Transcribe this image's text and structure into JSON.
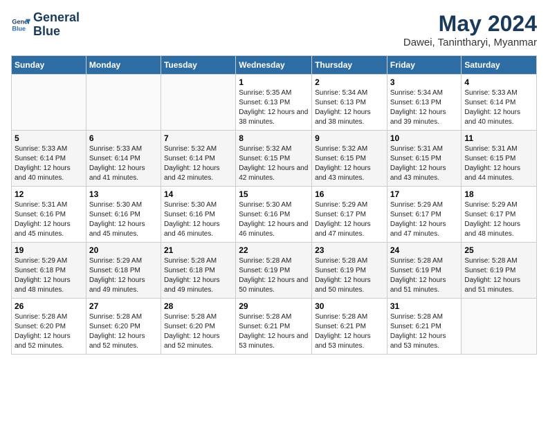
{
  "logo": {
    "line1": "General",
    "line2": "Blue"
  },
  "title": "May 2024",
  "location": "Dawei, Tanintharyi, Myanmar",
  "days_header": [
    "Sunday",
    "Monday",
    "Tuesday",
    "Wednesday",
    "Thursday",
    "Friday",
    "Saturday"
  ],
  "weeks": [
    [
      {
        "day": "",
        "sunrise": "",
        "sunset": "",
        "daylight": ""
      },
      {
        "day": "",
        "sunrise": "",
        "sunset": "",
        "daylight": ""
      },
      {
        "day": "",
        "sunrise": "",
        "sunset": "",
        "daylight": ""
      },
      {
        "day": "1",
        "sunrise": "Sunrise: 5:35 AM",
        "sunset": "Sunset: 6:13 PM",
        "daylight": "Daylight: 12 hours and 38 minutes."
      },
      {
        "day": "2",
        "sunrise": "Sunrise: 5:34 AM",
        "sunset": "Sunset: 6:13 PM",
        "daylight": "Daylight: 12 hours and 38 minutes."
      },
      {
        "day": "3",
        "sunrise": "Sunrise: 5:34 AM",
        "sunset": "Sunset: 6:13 PM",
        "daylight": "Daylight: 12 hours and 39 minutes."
      },
      {
        "day": "4",
        "sunrise": "Sunrise: 5:33 AM",
        "sunset": "Sunset: 6:14 PM",
        "daylight": "Daylight: 12 hours and 40 minutes."
      }
    ],
    [
      {
        "day": "5",
        "sunrise": "Sunrise: 5:33 AM",
        "sunset": "Sunset: 6:14 PM",
        "daylight": "Daylight: 12 hours and 40 minutes."
      },
      {
        "day": "6",
        "sunrise": "Sunrise: 5:33 AM",
        "sunset": "Sunset: 6:14 PM",
        "daylight": "Daylight: 12 hours and 41 minutes."
      },
      {
        "day": "7",
        "sunrise": "Sunrise: 5:32 AM",
        "sunset": "Sunset: 6:14 PM",
        "daylight": "Daylight: 12 hours and 42 minutes."
      },
      {
        "day": "8",
        "sunrise": "Sunrise: 5:32 AM",
        "sunset": "Sunset: 6:15 PM",
        "daylight": "Daylight: 12 hours and 42 minutes."
      },
      {
        "day": "9",
        "sunrise": "Sunrise: 5:32 AM",
        "sunset": "Sunset: 6:15 PM",
        "daylight": "Daylight: 12 hours and 43 minutes."
      },
      {
        "day": "10",
        "sunrise": "Sunrise: 5:31 AM",
        "sunset": "Sunset: 6:15 PM",
        "daylight": "Daylight: 12 hours and 43 minutes."
      },
      {
        "day": "11",
        "sunrise": "Sunrise: 5:31 AM",
        "sunset": "Sunset: 6:15 PM",
        "daylight": "Daylight: 12 hours and 44 minutes."
      }
    ],
    [
      {
        "day": "12",
        "sunrise": "Sunrise: 5:31 AM",
        "sunset": "Sunset: 6:16 PM",
        "daylight": "Daylight: 12 hours and 45 minutes."
      },
      {
        "day": "13",
        "sunrise": "Sunrise: 5:30 AM",
        "sunset": "Sunset: 6:16 PM",
        "daylight": "Daylight: 12 hours and 45 minutes."
      },
      {
        "day": "14",
        "sunrise": "Sunrise: 5:30 AM",
        "sunset": "Sunset: 6:16 PM",
        "daylight": "Daylight: 12 hours and 46 minutes."
      },
      {
        "day": "15",
        "sunrise": "Sunrise: 5:30 AM",
        "sunset": "Sunset: 6:16 PM",
        "daylight": "Daylight: 12 hours and 46 minutes."
      },
      {
        "day": "16",
        "sunrise": "Sunrise: 5:29 AM",
        "sunset": "Sunset: 6:17 PM",
        "daylight": "Daylight: 12 hours and 47 minutes."
      },
      {
        "day": "17",
        "sunrise": "Sunrise: 5:29 AM",
        "sunset": "Sunset: 6:17 PM",
        "daylight": "Daylight: 12 hours and 47 minutes."
      },
      {
        "day": "18",
        "sunrise": "Sunrise: 5:29 AM",
        "sunset": "Sunset: 6:17 PM",
        "daylight": "Daylight: 12 hours and 48 minutes."
      }
    ],
    [
      {
        "day": "19",
        "sunrise": "Sunrise: 5:29 AM",
        "sunset": "Sunset: 6:18 PM",
        "daylight": "Daylight: 12 hours and 48 minutes."
      },
      {
        "day": "20",
        "sunrise": "Sunrise: 5:29 AM",
        "sunset": "Sunset: 6:18 PM",
        "daylight": "Daylight: 12 hours and 49 minutes."
      },
      {
        "day": "21",
        "sunrise": "Sunrise: 5:28 AM",
        "sunset": "Sunset: 6:18 PM",
        "daylight": "Daylight: 12 hours and 49 minutes."
      },
      {
        "day": "22",
        "sunrise": "Sunrise: 5:28 AM",
        "sunset": "Sunset: 6:19 PM",
        "daylight": "Daylight: 12 hours and 50 minutes."
      },
      {
        "day": "23",
        "sunrise": "Sunrise: 5:28 AM",
        "sunset": "Sunset: 6:19 PM",
        "daylight": "Daylight: 12 hours and 50 minutes."
      },
      {
        "day": "24",
        "sunrise": "Sunrise: 5:28 AM",
        "sunset": "Sunset: 6:19 PM",
        "daylight": "Daylight: 12 hours and 51 minutes."
      },
      {
        "day": "25",
        "sunrise": "Sunrise: 5:28 AM",
        "sunset": "Sunset: 6:19 PM",
        "daylight": "Daylight: 12 hours and 51 minutes."
      }
    ],
    [
      {
        "day": "26",
        "sunrise": "Sunrise: 5:28 AM",
        "sunset": "Sunset: 6:20 PM",
        "daylight": "Daylight: 12 hours and 52 minutes."
      },
      {
        "day": "27",
        "sunrise": "Sunrise: 5:28 AM",
        "sunset": "Sunset: 6:20 PM",
        "daylight": "Daylight: 12 hours and 52 minutes."
      },
      {
        "day": "28",
        "sunrise": "Sunrise: 5:28 AM",
        "sunset": "Sunset: 6:20 PM",
        "daylight": "Daylight: 12 hours and 52 minutes."
      },
      {
        "day": "29",
        "sunrise": "Sunrise: 5:28 AM",
        "sunset": "Sunset: 6:21 PM",
        "daylight": "Daylight: 12 hours and 53 minutes."
      },
      {
        "day": "30",
        "sunrise": "Sunrise: 5:28 AM",
        "sunset": "Sunset: 6:21 PM",
        "daylight": "Daylight: 12 hours and 53 minutes."
      },
      {
        "day": "31",
        "sunrise": "Sunrise: 5:28 AM",
        "sunset": "Sunset: 6:21 PM",
        "daylight": "Daylight: 12 hours and 53 minutes."
      },
      {
        "day": "",
        "sunrise": "",
        "sunset": "",
        "daylight": ""
      }
    ]
  ]
}
